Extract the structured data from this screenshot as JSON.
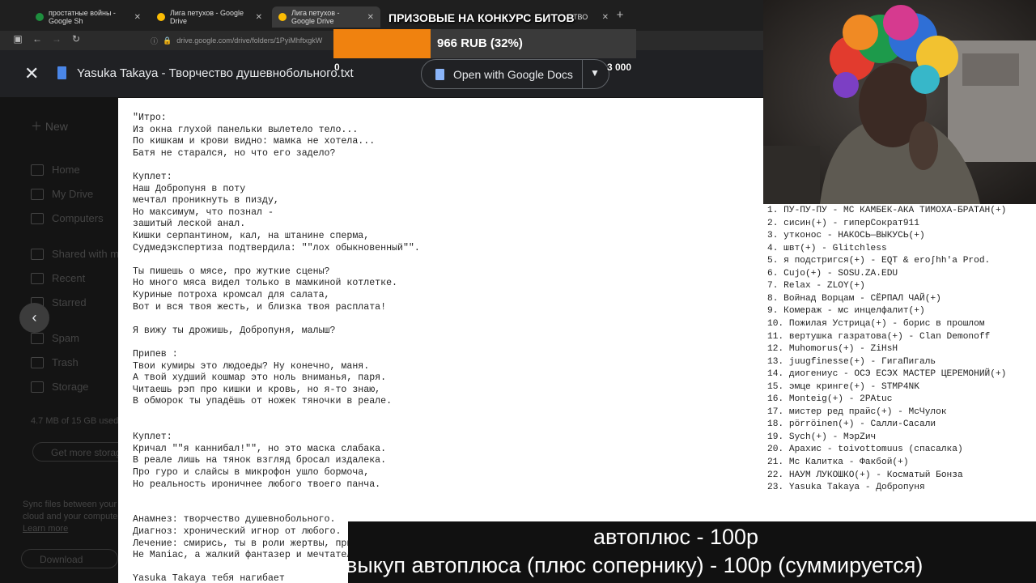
{
  "browser": {
    "tabs": [
      {
        "label": "простатные войны - Google Sh",
        "active": false
      },
      {
        "label": "Лига петухов - Google Drive",
        "active": false
      },
      {
        "label": "Лига петухов - Google Drive",
        "active": true
      },
      {
        "label": "ТВО",
        "active": false
      }
    ],
    "new_tab": "+",
    "url": "drive.google.com/drive/folders/1PyiMhftxgkW"
  },
  "viewer": {
    "close_icon": "✕",
    "file_title": "Yasuka Takaya - Творчество душевнобольного.txt",
    "open_with": "Open with Google Docs",
    "dropdown_arrow": "▼",
    "back_icon": "‹"
  },
  "sidebar": {
    "new_label": "New",
    "items": [
      "Home",
      "My Drive",
      "Computers",
      "Shared with me",
      "Recent",
      "Starred",
      "Spam",
      "Trash",
      "Storage"
    ],
    "storage_text": "4.7 MB of 15 GB used",
    "get_storage": "Get more storage",
    "sync_text": [
      "Sync files between your",
      "cloud and your computer",
      "Learn more"
    ],
    "download": "Download"
  },
  "document": {
    "lines": [
      "\"Итро:",
      "Из окна глухой панельки вылетело тело...",
      "По кишкам и крови видно: мамка не хотела...",
      "Батя не старался, но что его задело?",
      "",
      "Куплет:",
      "Наш Добропуня в поту",
      "мечтал проникнуть в пизду,",
      "Но максимум, что познал -",
      "зашитый леской анал.",
      "Кишки серпантином, кал, на штанине сперма,",
      "Судмедэкспертиза подтвердила: \"\"лох обыкновенный\"\".",
      "",
      "Ты пишешь о мясе, про жуткие сцены?",
      "Но много мяса видел только в мамкиной котлетке.",
      "Куриные потроха кромсал для салата,",
      "Вот и вся твоя жесть, и близка твоя расплата!",
      "",
      "Я вижу ты дрожишь, Добропуня, малыш?",
      "",
      "Припев :",
      "Твои кумиры это людоеды? Ну конечно, маня.",
      "А твой худший кошмар это ноль вниманья, паря.",
      "Читаешь рэп про кишки и кровь, но я-то знаю,",
      "В обморок ты упадёшь от ножек тяночки в реале.",
      "",
      "",
      "Куплет:",
      "Кричал \"\"я каннибал!\"\", но это маска слабака.",
      "В реале лишь на тянок взгляд бросал издалека.",
      "Про гуро и слайсы в микрофон ушло бормоча,",
      "Но реальность ироничнее любого твоего панча.",
      "",
      "",
      "Анамнез: творчество душевнобольного.",
      "Диагноз: хронический игнор от любого.",
      "Лечение: смирись, ты в роли жертвы, приятель.",
      "Не Maniac, а жалкий фантазер и мечтатель.",
      "",
      "Yasuka Takaya тебя нагибает"
    ]
  },
  "donation": {
    "title": "ПРИЗОВЫЕ НА КОНКУРС БИТОВ",
    "amount_text": "966 RUB (32%)",
    "progress": 0.322,
    "min_label": "0",
    "max_label": "3 000"
  },
  "participants": [
    "1. ПУ-ПУ-ПУ - МС КАМБЕК-АКА ТИМОХА-БРАТАН(+)",
    "2. сисин(+) - гиперСократ911",
    "3. утконос - НАКОСЬ—ВЫКУСЬ(+)",
    "4. швт(+) - Glitchless",
    "5. я подстригся(+) - EQT & eroʃhh'a Proԁ.",
    "6. Cujo(+) - SOSU.ZA.EDU",
    "7. Relax - ZLOY(+)",
    "8. Войнад Ворцам - СЁРПАЛ ЧАЙ(+)",
    "9. Комераж - мс инцелфалит(+)",
    "10. Пожилая Устрица(+) - борис в прошлом",
    "11. вертушка газратова(+) - Clan Demonoff",
    "12. Muhomorus(+) - ZiHsH",
    "13. juugfinesse(+) - ГигаПигаль",
    "14. диогениус - ОСЭ ЕСЭХ МАСТЕР ЦЕРЕМОНИЙ(+)",
    "15. эмце кринге(+) - STMP4NK",
    "16. Monteig(+) - 2PAtuc",
    "17. мистер ред прайс(+) - МсЧулок",
    "18. pörröinen(+) - Салли-Сасали",
    "19. Sych(+) - МэрZич",
    "20. Арахис - toivottomuus (спасалка)",
    "21. Мс Калитка - Факбой(+)",
    "22. НАУМ ЛУКОШКО(+) - Косматый Бонза",
    "23. Yasuka Takaya - Добропуня"
  ],
  "captions": {
    "line1": "автоплюс - 100р",
    "line2": "выкуп автоплюса (плюс сопернику) - 100р (суммируется)"
  },
  "colors": {
    "progress_fill": "#f0820f",
    "progress_track": "#3a3a3a",
    "drive_header": "#202124"
  }
}
